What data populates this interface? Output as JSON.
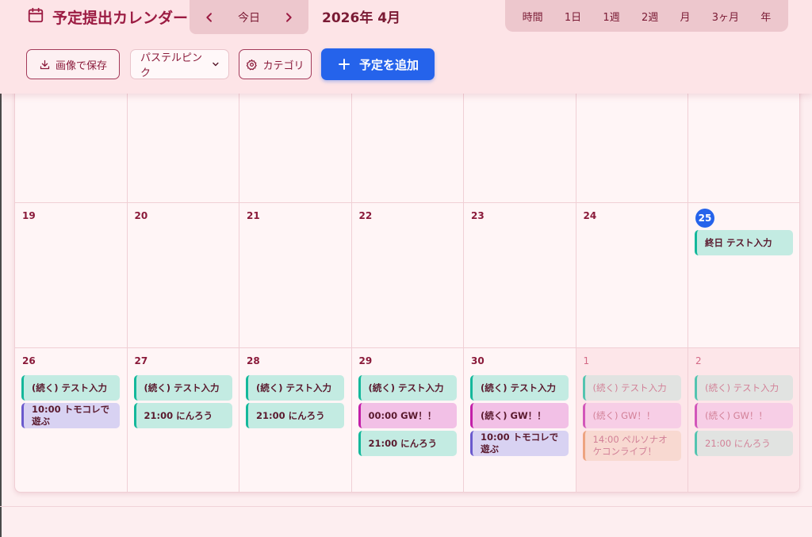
{
  "app": {
    "title": "予定提出カレンダー"
  },
  "nav": {
    "today_label": "今日",
    "month_label": "2026年 4月"
  },
  "views": [
    "時間",
    "1日",
    "1週",
    "2週",
    "月",
    "3ヶ月",
    "年"
  ],
  "toolbar": {
    "save_label": "画像で保存",
    "theme_value": "パステルピンク",
    "category_label": "カテゴリ",
    "add_label": "予定を追加"
  },
  "colors": {
    "accent": "#2563eb",
    "teal": "#14b89b",
    "purple": "#6a5acd",
    "pink": "#c21fa8",
    "orange": "#e88a58"
  },
  "weeks": [
    {
      "days": [
        {
          "num": "",
          "other": false,
          "today": false,
          "events": []
        },
        {
          "num": "",
          "other": false,
          "today": false,
          "events": []
        },
        {
          "num": "",
          "other": false,
          "today": false,
          "events": []
        },
        {
          "num": "",
          "other": false,
          "today": false,
          "events": []
        },
        {
          "num": "",
          "other": false,
          "today": false,
          "events": []
        },
        {
          "num": "",
          "other": false,
          "today": false,
          "events": []
        },
        {
          "num": "",
          "other": false,
          "today": false,
          "events": []
        }
      ]
    },
    {
      "days": [
        {
          "num": "19",
          "other": false,
          "today": false,
          "events": []
        },
        {
          "num": "20",
          "other": false,
          "today": false,
          "events": []
        },
        {
          "num": "21",
          "other": false,
          "today": false,
          "events": []
        },
        {
          "num": "22",
          "other": false,
          "today": false,
          "events": []
        },
        {
          "num": "23",
          "other": false,
          "today": false,
          "events": []
        },
        {
          "num": "24",
          "other": false,
          "today": false,
          "events": []
        },
        {
          "num": "25",
          "other": false,
          "today": true,
          "events": [
            {
              "text": "終日 テスト入力",
              "color": "teal"
            }
          ]
        }
      ]
    },
    {
      "days": [
        {
          "num": "26",
          "other": false,
          "today": false,
          "events": [
            {
              "text": "(続く) テスト入力",
              "color": "teal"
            },
            {
              "text": "10:00 トモコレで遊ぶ",
              "color": "purple"
            }
          ]
        },
        {
          "num": "27",
          "other": false,
          "today": false,
          "events": [
            {
              "text": "(続く) テスト入力",
              "color": "teal"
            },
            {
              "text": "21:00 にんろう",
              "color": "teal"
            }
          ]
        },
        {
          "num": "28",
          "other": false,
          "today": false,
          "events": [
            {
              "text": "(続く) テスト入力",
              "color": "teal"
            },
            {
              "text": "21:00 にんろう",
              "color": "teal"
            }
          ]
        },
        {
          "num": "29",
          "other": false,
          "today": false,
          "events": [
            {
              "text": "(続く) テスト入力",
              "color": "teal"
            },
            {
              "text": "00:00 GW！！",
              "color": "pink"
            },
            {
              "text": "21:00 にんろう",
              "color": "teal"
            }
          ]
        },
        {
          "num": "30",
          "other": false,
          "today": false,
          "events": [
            {
              "text": "(続く) テスト入力",
              "color": "teal"
            },
            {
              "text": "(続く) GW！！",
              "color": "pink"
            },
            {
              "text": "10:00 トモコレで遊ぶ",
              "color": "purple"
            }
          ]
        },
        {
          "num": "1",
          "other": true,
          "today": false,
          "events": [
            {
              "text": "(続く) テスト入力",
              "color": "teal"
            },
            {
              "text": "(続く) GW！！",
              "color": "pink"
            },
            {
              "text": "14:00 ペルソナオケコンライブ！",
              "color": "orange"
            }
          ]
        },
        {
          "num": "2",
          "other": true,
          "today": false,
          "events": [
            {
              "text": "(続く) テスト入力",
              "color": "teal"
            },
            {
              "text": "(続く) GW！！",
              "color": "pink"
            },
            {
              "text": "21:00 にんろう",
              "color": "teal"
            }
          ]
        }
      ]
    }
  ]
}
